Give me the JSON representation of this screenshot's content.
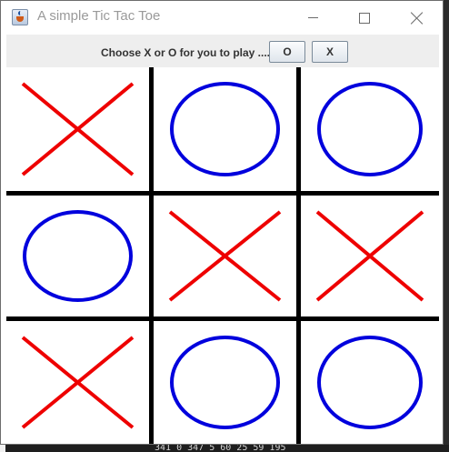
{
  "window": {
    "title": "A simple Tic Tac Toe",
    "icon": "java-cup-icon"
  },
  "controls": {
    "prompt": "Choose X or O for you to play ....",
    "o_button": "O",
    "x_button": "X"
  },
  "board": {
    "cells": [
      "X",
      "O",
      "O",
      "O",
      "X",
      "X",
      "X",
      "O",
      "O"
    ],
    "colors": {
      "x": "#ee0000",
      "o": "#0000dd",
      "grid": "#000000"
    }
  },
  "background": {
    "terminal_fragment": "341  0  347  5  60  25  59  195"
  }
}
